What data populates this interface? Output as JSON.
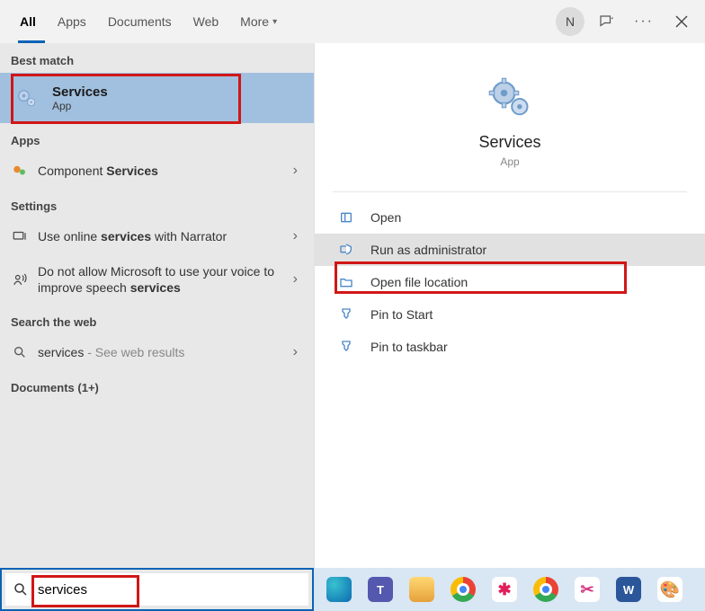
{
  "tabs": {
    "all": "All",
    "apps": "Apps",
    "documents": "Documents",
    "web": "Web",
    "more": "More"
  },
  "user": {
    "initial": "N"
  },
  "left": {
    "best_match_label": "Best match",
    "best_match": {
      "title": "Services",
      "subtitle": "App"
    },
    "apps_label": "Apps",
    "apps_item_prefix": "Component ",
    "apps_item_strong": "Services",
    "settings_label": "Settings",
    "settings_item1_a": "Use online ",
    "settings_item1_b": "services",
    "settings_item1_c": " with Narrator",
    "settings_item2_a": "Do not allow Microsoft to use your voice to improve speech ",
    "settings_item2_b": "services",
    "web_label": "Search the web",
    "web_item_name": "services",
    "web_item_suffix": " - See web results",
    "docs_label": "Documents (1+)"
  },
  "right": {
    "title": "Services",
    "subtitle": "App",
    "open": "Open",
    "run_admin": "Run as administrator",
    "open_loc": "Open file location",
    "pin_start": "Pin to Start",
    "pin_taskbar": "Pin to taskbar"
  },
  "search": {
    "value": "services"
  }
}
